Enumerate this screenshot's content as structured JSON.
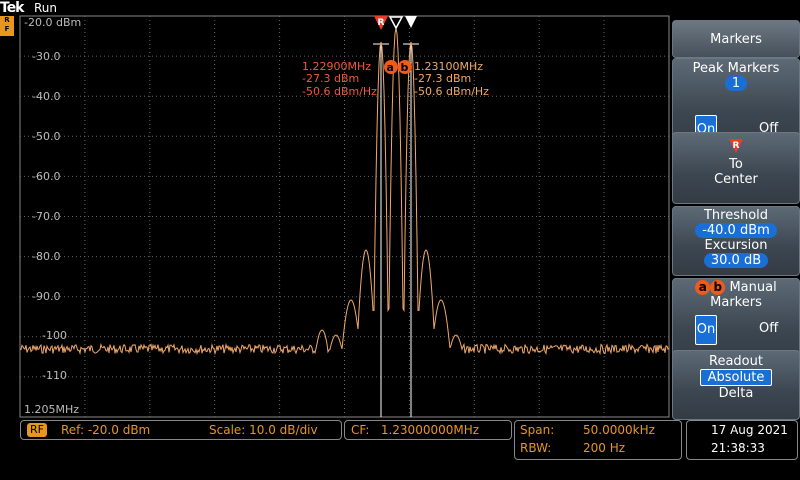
{
  "header": {
    "logo": "Tek",
    "status": "Run",
    "badge_lines": [
      "R",
      "F",
      "M"
    ]
  },
  "plot": {
    "y_labels": [
      "-20.0 dBm",
      "-30.0",
      "-40.0",
      "-50.0",
      "-60.0",
      "-70.0",
      "-80.0",
      "-90.0",
      "-100",
      "-110"
    ],
    "start_freq": "1.205MHz",
    "marker_a": {
      "letter": "a",
      "freq": "1.22900MHz",
      "level": "-27.3 dBm",
      "density": "-50.6 dBm/Hz"
    },
    "marker_b": {
      "letter": "b",
      "freq": "1.23100MHz",
      "level": "-27.3 dBm",
      "density": "-50.6 dBm/Hz"
    },
    "ref_marker": "R"
  },
  "menu": {
    "title": "Markers",
    "peak_markers": {
      "label": "Peak Markers",
      "count": "1",
      "on": "On",
      "off": "Off"
    },
    "to_center": {
      "icon": "R",
      "line1": "To",
      "line2": "Center"
    },
    "threshold": {
      "label": "Threshold",
      "value": "-40.0 dBm",
      "excursion_label": "Excursion",
      "excursion_value": "30.0 dB"
    },
    "manual": {
      "a": "a",
      "b": "b",
      "line1": "Manual",
      "line2": "Markers",
      "on": "On",
      "off": "Off"
    },
    "readout": {
      "label": "Readout",
      "absolute": "Absolute",
      "delta": "Delta"
    }
  },
  "status_bar": {
    "rf": "RF",
    "ref": "Ref: -20.0 dBm",
    "scale": "Scale: 10.0 dB/div",
    "cf": "CF:   1.23000000MHz",
    "span_label": "Span:",
    "span_value": "50.0000kHz",
    "rbw_label": "RBW:",
    "rbw_value": "200 Hz",
    "date": "17 Aug 2021",
    "time": "21:38:33"
  },
  "colors": {
    "trace": "#f0a868",
    "marker": "#ef5a1e",
    "accent": "#1a6fd6",
    "rf": "#e8961e"
  }
}
